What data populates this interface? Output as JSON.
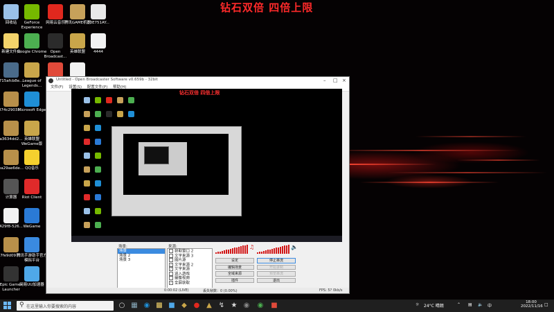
{
  "desktop": {
    "banner": "钻石双倍 四倍上限",
    "icons": [
      {
        "label": "回收站",
        "color": "#9ac1e8"
      },
      {
        "label": "GeForce Experience",
        "color": "#76b900"
      },
      {
        "label": "网易云音乐",
        "color": "#e0281e"
      },
      {
        "label": "腾讯GAME机器",
        "color": "#c7a15a"
      },
      {
        "label": "E3E751AY...",
        "color": "#e8e8e8"
      },
      {
        "label": "新建文件夹",
        "color": "#f3d36a"
      },
      {
        "label": "Google Chrome",
        "color": "#4caf50"
      },
      {
        "label": "Open Broadcast...",
        "color": "#2b2b2b"
      },
      {
        "label": "英雄联盟",
        "color": "#c9a64a"
      },
      {
        "label": "4444",
        "color": "#f2f2f2"
      },
      {
        "label": "715afcb8e...",
        "color": "#4a6b8a"
      },
      {
        "label": "League of Legends...",
        "color": "#c9a64a"
      },
      {
        "label": "",
        "color": "#e04a3a"
      },
      {
        "label": "",
        "color": "#f2f2f2"
      },
      {
        "label": "874c29035...",
        "color": "#b8904a"
      },
      {
        "label": "Microsoft Edge",
        "color": "#1f8fd6"
      },
      {
        "label": "a3634dd2...",
        "color": "#b8904a"
      },
      {
        "label": "英雄联盟 WeGame版",
        "color": "#c9a64a"
      },
      {
        "label": "ea29ae6de...",
        "color": "#b8904a"
      },
      {
        "label": "QQ音乐",
        "color": "#f5d02e"
      },
      {
        "label": "计算器",
        "color": "#555"
      },
      {
        "label": "Riot Client",
        "color": "#e02a2a"
      },
      {
        "label": "429f8-526...",
        "color": "#f2f2f2"
      },
      {
        "label": "WeGame",
        "color": "#2a7ad6"
      },
      {
        "label": "7fe9d097...",
        "color": "#b8904a"
      },
      {
        "label": "腾讯手游助手官方 模拟平台",
        "color": "#3a8ae0"
      },
      {
        "label": "Epic Games Launcher",
        "color": "#333"
      },
      {
        "label": "网易UU加速器",
        "color": "#4fa8e8"
      }
    ]
  },
  "obs": {
    "title": "Untitled - Open Broadcaster Software v0.659b - 32bit",
    "menu": [
      "文件(F)",
      "设置(S)",
      "配置文件(P)",
      "帮助(H)"
    ],
    "preview_banner": "钻石双倍 四倍上限",
    "scenes_header": "场景:",
    "scenes": [
      "场景",
      "场景 2",
      "场景 3"
    ],
    "sources_header": "来源:",
    "sources": [
      {
        "label": "获取窗口 2",
        "checked": false
      },
      {
        "label": "文字来源 3",
        "checked": false
      },
      {
        "label": "图片源",
        "checked": false
      },
      {
        "label": "文字来源 2",
        "checked": true
      },
      {
        "label": "文字来源",
        "checked": true
      },
      {
        "label": "进入游戏",
        "checked": false
      },
      {
        "label": "摄像视频",
        "checked": false
      },
      {
        "label": "全屏获取",
        "checked": true
      }
    ],
    "buttons_left": [
      "设定",
      "编辑场景",
      "全域来源",
      "插件"
    ],
    "buttons_right": [
      {
        "label": "停止串流",
        "disabled": false
      },
      {
        "label": "开始录制",
        "disabled": true
      },
      {
        "label": "预览串流",
        "disabled": true
      },
      {
        "label": "退出",
        "disabled": false
      }
    ],
    "status": {
      "time": "0:00:02 (LIVE)",
      "dropped": "丢失帧数：0 (0.00%)",
      "fps": "FPS: 5?",
      "bitrate": "0kb/s"
    }
  },
  "taskbar": {
    "search_placeholder": "在这里输入你要搜索的内容",
    "weather": "24°C 晴朗",
    "lang": "中",
    "time": "18:00",
    "date": "2022/11/16"
  },
  "colors": {
    "accent_red": "#ff2a2a",
    "meter_red": "#d21616",
    "selection_blue": "#3b8be0"
  }
}
